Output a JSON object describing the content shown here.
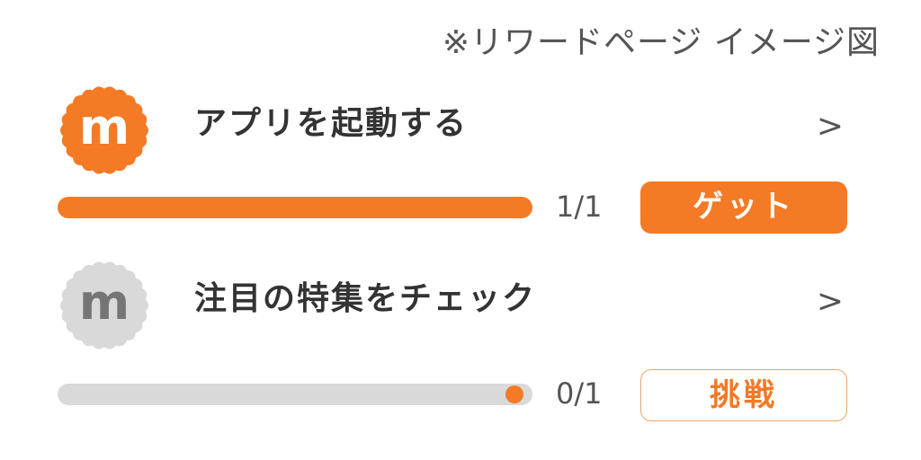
{
  "note": "※リワードページ イメージ図",
  "colors": {
    "accent": "#f47a25",
    "inactive_badge": "#d9d9d9",
    "track": "#d9d9d9",
    "text": "#333333"
  },
  "missions": [
    {
      "badge_letter": "m",
      "badge_state": "active",
      "title": "アプリを起動する",
      "chevron": ">",
      "progress": {
        "current": 1,
        "total": 1,
        "fraction": 1.0
      },
      "count_text": "1/1",
      "action_label": "ゲット",
      "action_style": "filled"
    },
    {
      "badge_letter": "m",
      "badge_state": "inactive",
      "title": "注目の特集をチェック",
      "chevron": ">",
      "progress": {
        "current": 0,
        "total": 1,
        "fraction": 0.0
      },
      "count_text": "0/1",
      "action_label": "挑戦",
      "action_style": "outlined"
    }
  ],
  "icons": {
    "badge": "scalloped-m-badge-icon",
    "chevron": "chevron-right-icon",
    "progress_marker": "progress-dot-icon"
  }
}
